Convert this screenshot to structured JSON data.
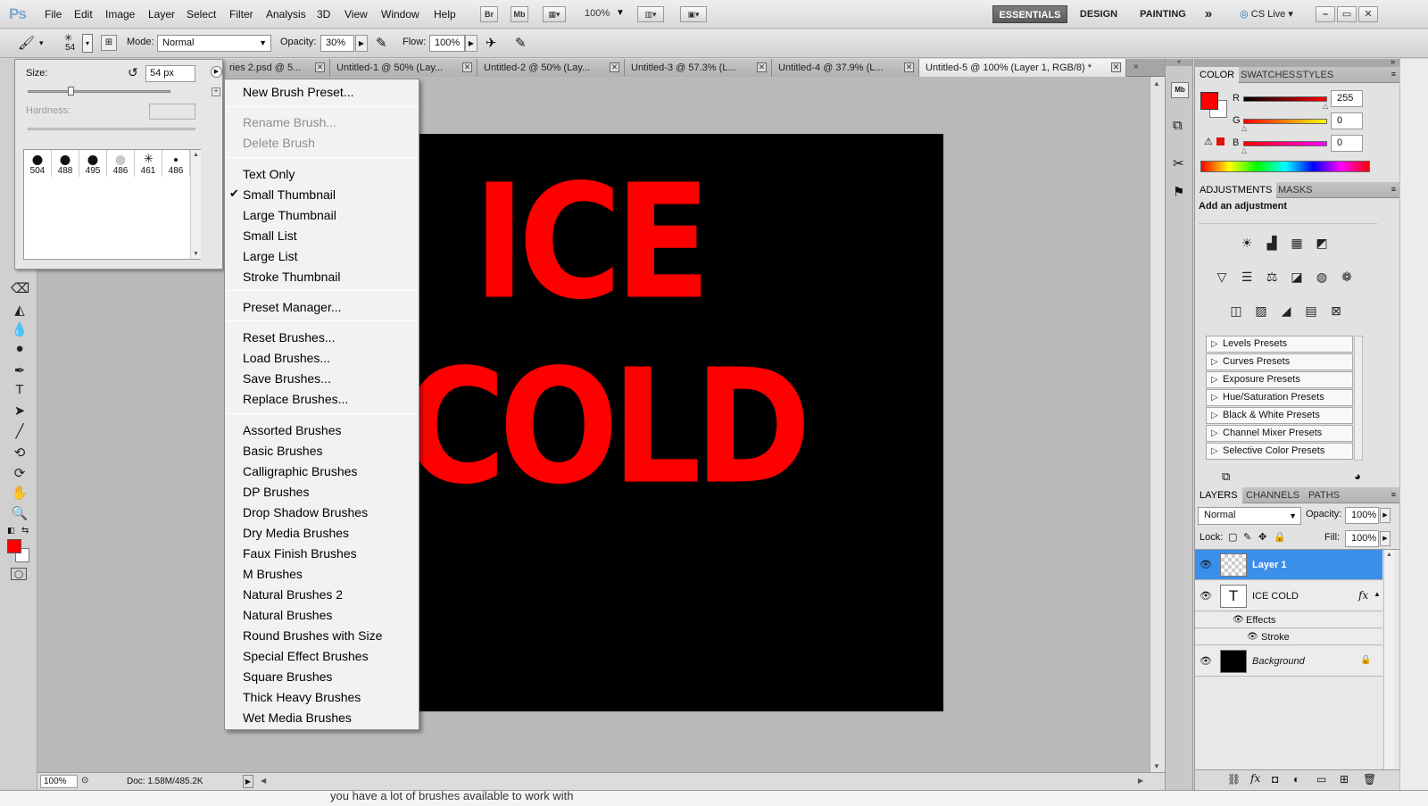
{
  "app": {
    "logo": "Ps"
  },
  "menubar": {
    "items": [
      "File",
      "Edit",
      "Image",
      "Layer",
      "Select",
      "Filter",
      "Analysis",
      "3D",
      "View",
      "Window",
      "Help"
    ],
    "bridge": "Br",
    "minibridge": "Mb",
    "zoom": "100%",
    "workspaces": [
      "ESSENTIALS",
      "DESIGN",
      "PAINTING"
    ],
    "more": "»",
    "cs_live": "CS Live"
  },
  "options": {
    "brush_size": "54",
    "mode_label": "Mode:",
    "mode_value": "Normal",
    "opacity_label": "Opacity:",
    "opacity_value": "30%",
    "flow_label": "Flow:",
    "flow_value": "100%"
  },
  "brush_picker": {
    "size_label": "Size:",
    "size_value": "54 px",
    "hardness_label": "Hardness:",
    "tips": [
      "504",
      "488",
      "495",
      "486",
      "461",
      "486"
    ]
  },
  "tabs": [
    {
      "label": "ries 2.psd @ 5..."
    },
    {
      "label": "Untitled-1 @ 50% (Lay..."
    },
    {
      "label": "Untitled-2 @ 50% (Lay..."
    },
    {
      "label": "Untitled-3 @ 57.3% (L..."
    },
    {
      "label": "Untitled-4 @ 37.9% (L..."
    },
    {
      "label": "Untitled-5 @ 100% (Layer 1, RGB/8) *"
    }
  ],
  "canvas_text": {
    "line1": "ICE",
    "line2": "COLD"
  },
  "status": {
    "zoom": "100%",
    "doc": "Doc: 1.58M/485.2K"
  },
  "context_menu": {
    "new_preset": "New Brush Preset...",
    "rename": "Rename Brush...",
    "delete": "Delete Brush",
    "views": [
      "Text Only",
      "Small Thumbnail",
      "Large Thumbnail",
      "Small List",
      "Large List",
      "Stroke Thumbnail"
    ],
    "preset_manager": "Preset Manager...",
    "actions": [
      "Reset Brushes...",
      "Load Brushes...",
      "Save Brushes...",
      "Replace Brushes..."
    ],
    "libraries": [
      "Assorted Brushes",
      "Basic Brushes",
      "Calligraphic Brushes",
      "DP Brushes",
      "Drop Shadow Brushes",
      "Dry Media Brushes",
      "Faux Finish Brushes",
      "M Brushes",
      "Natural Brushes 2",
      "Natural Brushes",
      "Round Brushes with Size",
      "Special Effect Brushes",
      "Square Brushes",
      "Thick Heavy Brushes",
      "Wet Media Brushes"
    ],
    "checked_view": "Small Thumbnail"
  },
  "color_panel": {
    "tabs": [
      "COLOR",
      "SWATCHES",
      "STYLES"
    ],
    "r_label": "R",
    "g_label": "G",
    "b_label": "B",
    "r_value": "255",
    "g_value": "0",
    "b_value": "0",
    "foreground": "#ff0000"
  },
  "adjustments_panel": {
    "tabs": [
      "ADJUSTMENTS",
      "MASKS"
    ],
    "heading": "Add an adjustment",
    "presets": [
      "Levels Presets",
      "Curves Presets",
      "Exposure Presets",
      "Hue/Saturation Presets",
      "Black & White Presets",
      "Channel Mixer Presets",
      "Selective Color Presets"
    ]
  },
  "layers_panel": {
    "tabs": [
      "LAYERS",
      "CHANNELS",
      "PATHS"
    ],
    "blend_mode": "Normal",
    "opacity_label": "Opacity:",
    "opacity_value": "100%",
    "lock_label": "Lock:",
    "fill_label": "Fill:",
    "fill_value": "100%",
    "layers": [
      "Layer 1",
      "ICE COLD",
      "Background"
    ],
    "effects_label": "Effects",
    "stroke_label": "Stroke",
    "fx": "fx",
    "type_glyph": "T"
  },
  "bottom_text": "you have a lot of brushes available to work with"
}
